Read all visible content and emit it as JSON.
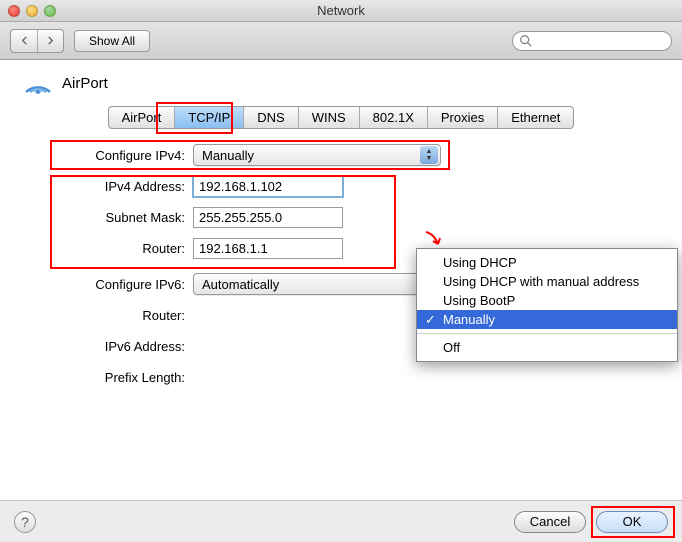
{
  "window": {
    "title": "Network"
  },
  "toolbar": {
    "show_all_label": "Show All",
    "search_placeholder": ""
  },
  "panel": {
    "title": "AirPort"
  },
  "tabs": [
    "AirPort",
    "TCP/IP",
    "DNS",
    "WINS",
    "802.1X",
    "Proxies",
    "Ethernet"
  ],
  "active_tab_index": 1,
  "fields": {
    "configure_ipv4_label": "Configure IPv4:",
    "configure_ipv4_value": "Manually",
    "ipv4_address_label": "IPv4 Address:",
    "ipv4_address_value": "192.168.1.102",
    "subnet_mask_label": "Subnet Mask:",
    "subnet_mask_value": "255.255.255.0",
    "router_label": "Router:",
    "router_value": "192.168.1.1",
    "configure_ipv6_label": "Configure IPv6:",
    "configure_ipv6_value": "Automatically",
    "router6_label": "Router:",
    "ipv6_address_label": "IPv6 Address:",
    "prefix_length_label": "Prefix Length:"
  },
  "dropdown": {
    "options": [
      "Using DHCP",
      "Using DHCP with manual address",
      "Using BootP",
      "Manually",
      "Off"
    ],
    "selected_index": 3
  },
  "buttons": {
    "cancel": "Cancel",
    "ok": "OK"
  }
}
